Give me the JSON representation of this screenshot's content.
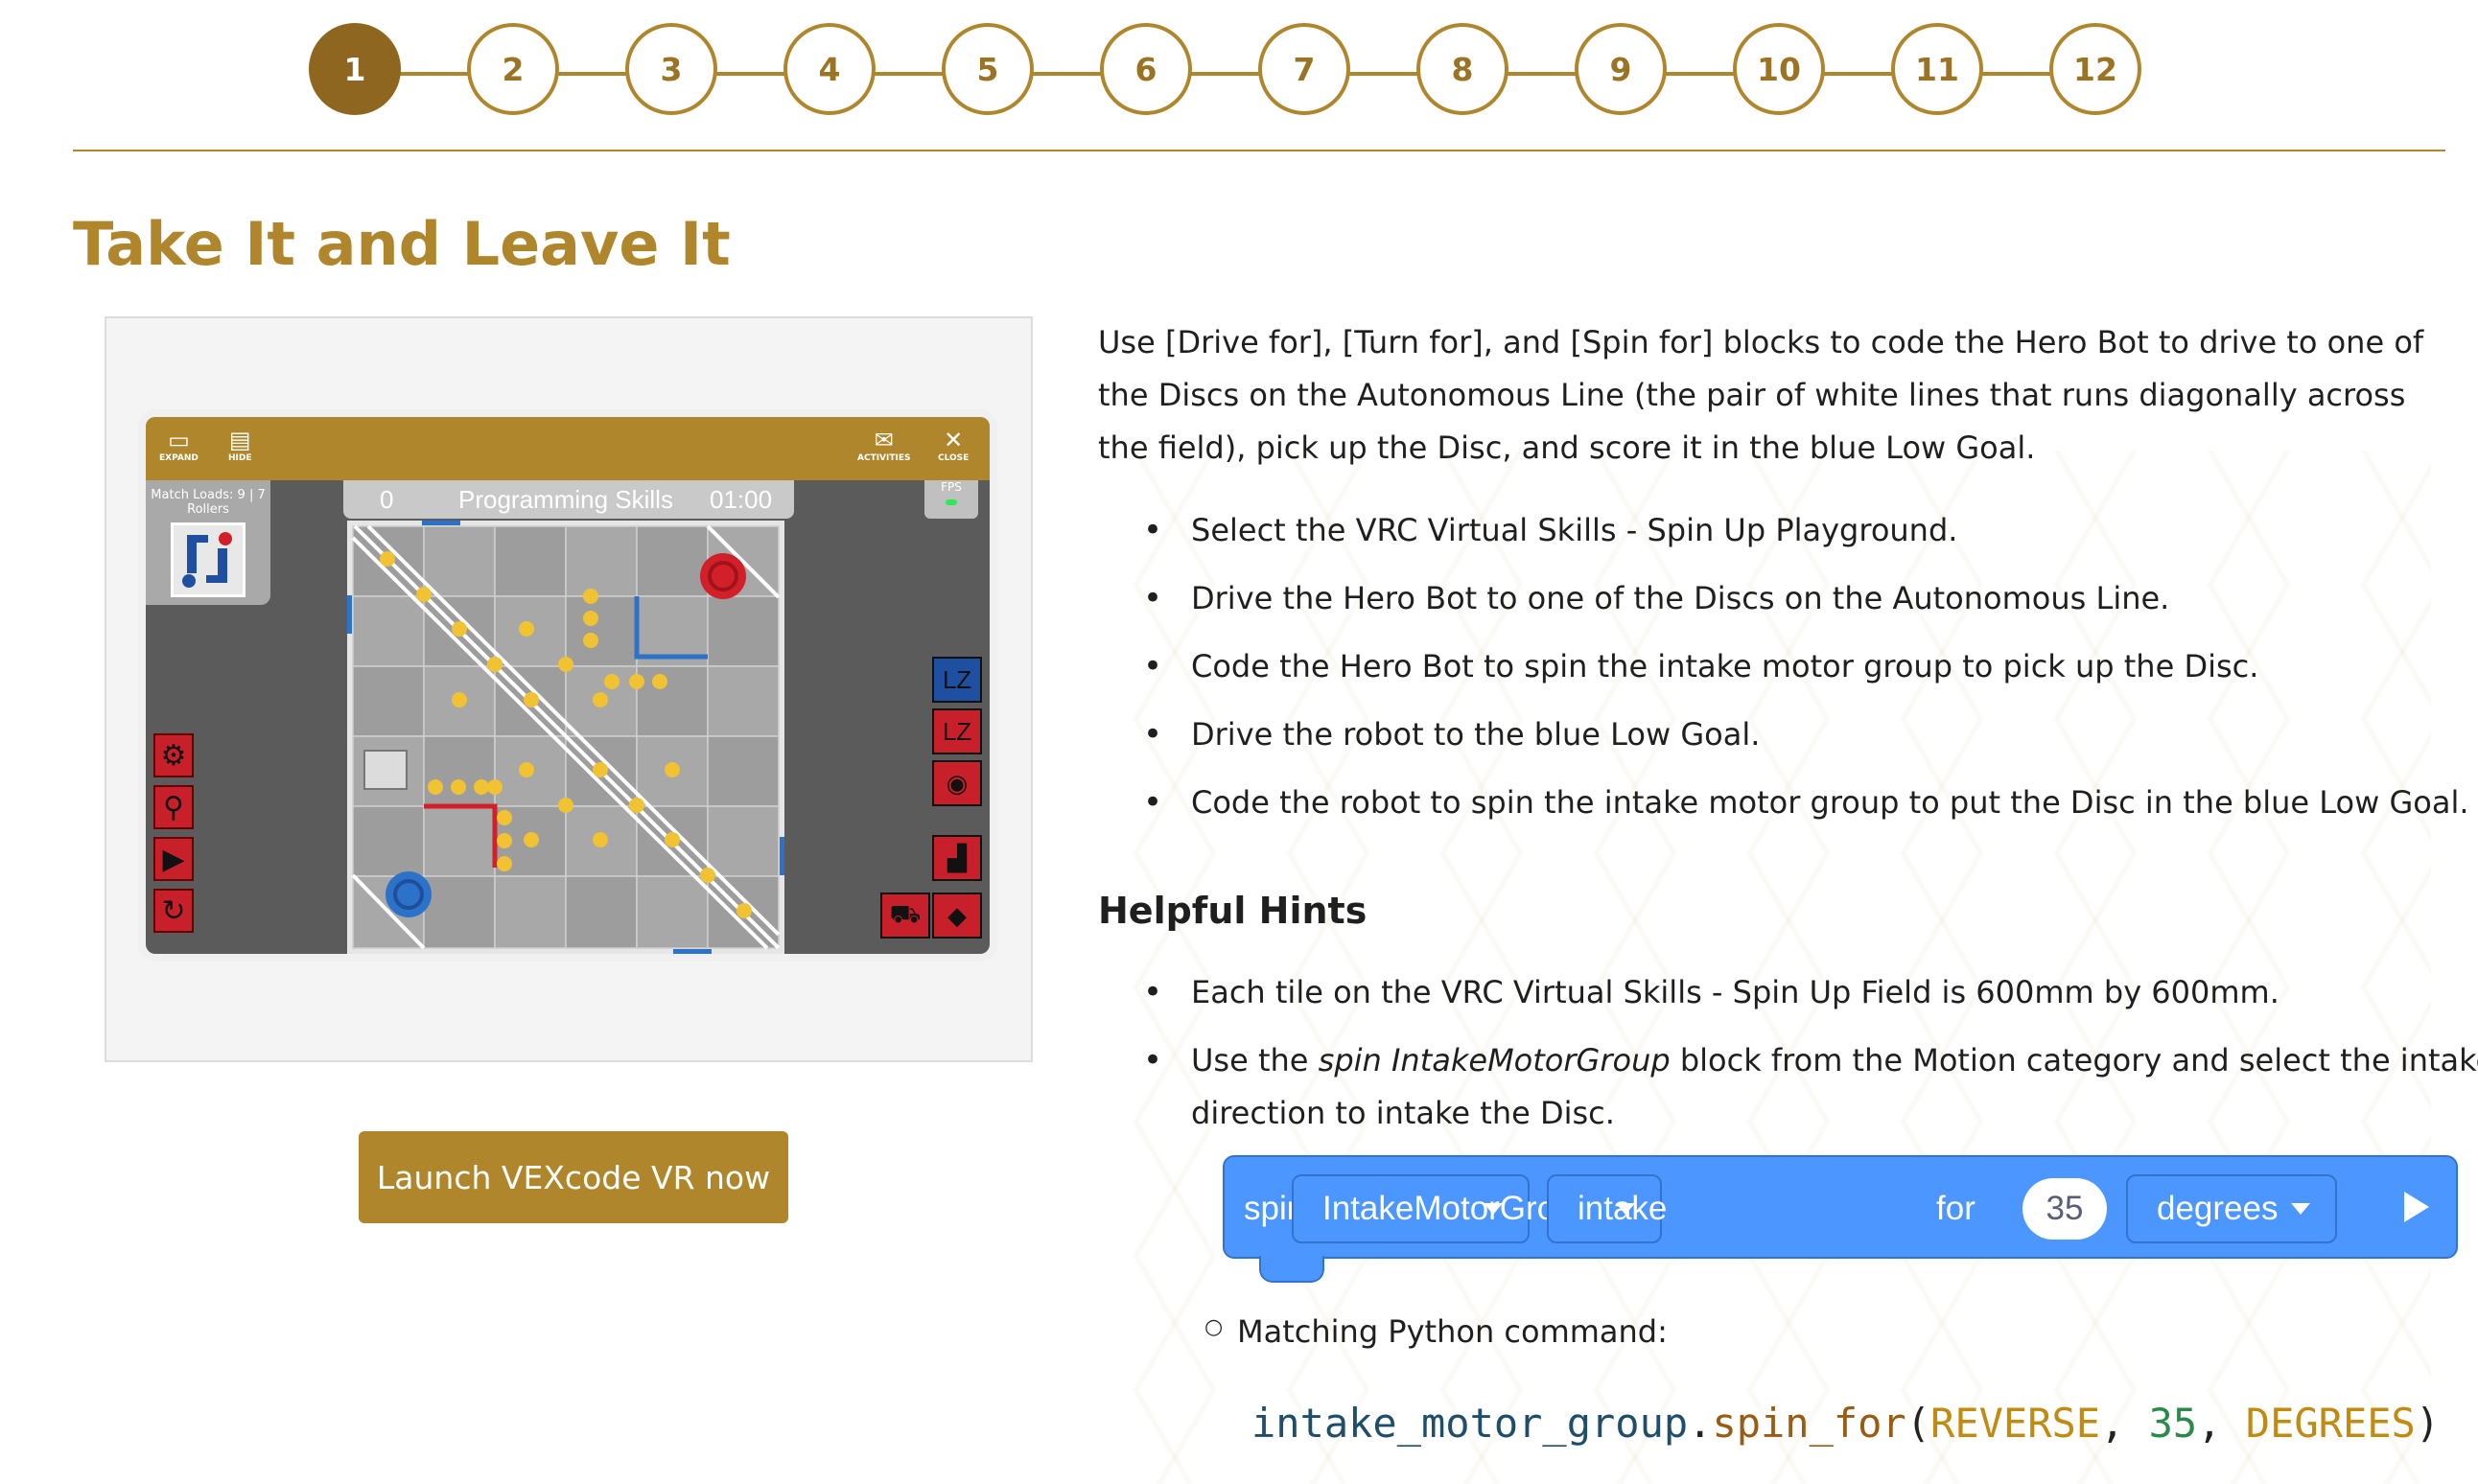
{
  "stepper": {
    "steps": [
      "1",
      "2",
      "3",
      "4",
      "5",
      "6",
      "7",
      "8",
      "9",
      "10",
      "11",
      "12"
    ],
    "active_index": 0
  },
  "page_title": "Take It and Leave It",
  "simulator": {
    "toolbar": {
      "expand": "EXPAND",
      "hide": "HIDE",
      "activities": "ACTIVITIES",
      "close": "CLOSE"
    },
    "score": "0",
    "mode": "Programming Skills",
    "timer": "01:00",
    "fps_label": "FPS",
    "match_loads": "Match Loads: 9 | 7",
    "rollers": "Rollers",
    "lz_blue": "LZ",
    "lz_red": "LZ"
  },
  "launch_button": "Launch VEXcode VR now",
  "intro": "Use [Drive for], [Turn for], and [Spin for] blocks to code the Hero Bot to drive to one of the Discs on the Autonomous Line (the pair of white lines that runs diagonally across the field), pick up the Disc, and score it in the blue Low Goal.",
  "tasks": [
    "Select the VRC Virtual Skills - Spin Up Playground.",
    "Drive the Hero Bot to one of the Discs on the Autonomous Line.",
    "Code the Hero Bot to spin the intake motor group to pick up the Disc.",
    "Drive the robot to the blue Low Goal.",
    "Code the robot to spin the intake motor group to put the Disc in the blue Low Goal."
  ],
  "hints_heading": "Helpful Hints",
  "hints": {
    "tile": "Each tile on the VRC Virtual Skills - Spin Up Field is 600mm by 600mm.",
    "use_prefix": "Use the ",
    "use_block": "spin IntakeMotorGroup",
    "use_suffix": " block from the Motion category and select the intake direction to intake the Disc."
  },
  "block": {
    "spin": "spin",
    "group": "IntakeMotorGroup",
    "direction": "intake",
    "for": "for",
    "amount": "35",
    "unit": "degrees"
  },
  "python_label": "Matching Python command:",
  "python": {
    "obj": "intake_motor_group",
    "dot": ".",
    "fn": "spin_for",
    "open": "(",
    "arg1": "REVERSE",
    "sep1": ", ",
    "arg2": "35",
    "sep2": ", ",
    "arg3": "DEGREES",
    "close": ")"
  },
  "colors": {
    "gold": "#b0862c",
    "gold_dark": "#8f661f",
    "block_blue": "#4c97ff",
    "disc_yellow": "#f1c232",
    "lz_blue": "#1f4fa0",
    "lz_red": "#c8202a"
  }
}
